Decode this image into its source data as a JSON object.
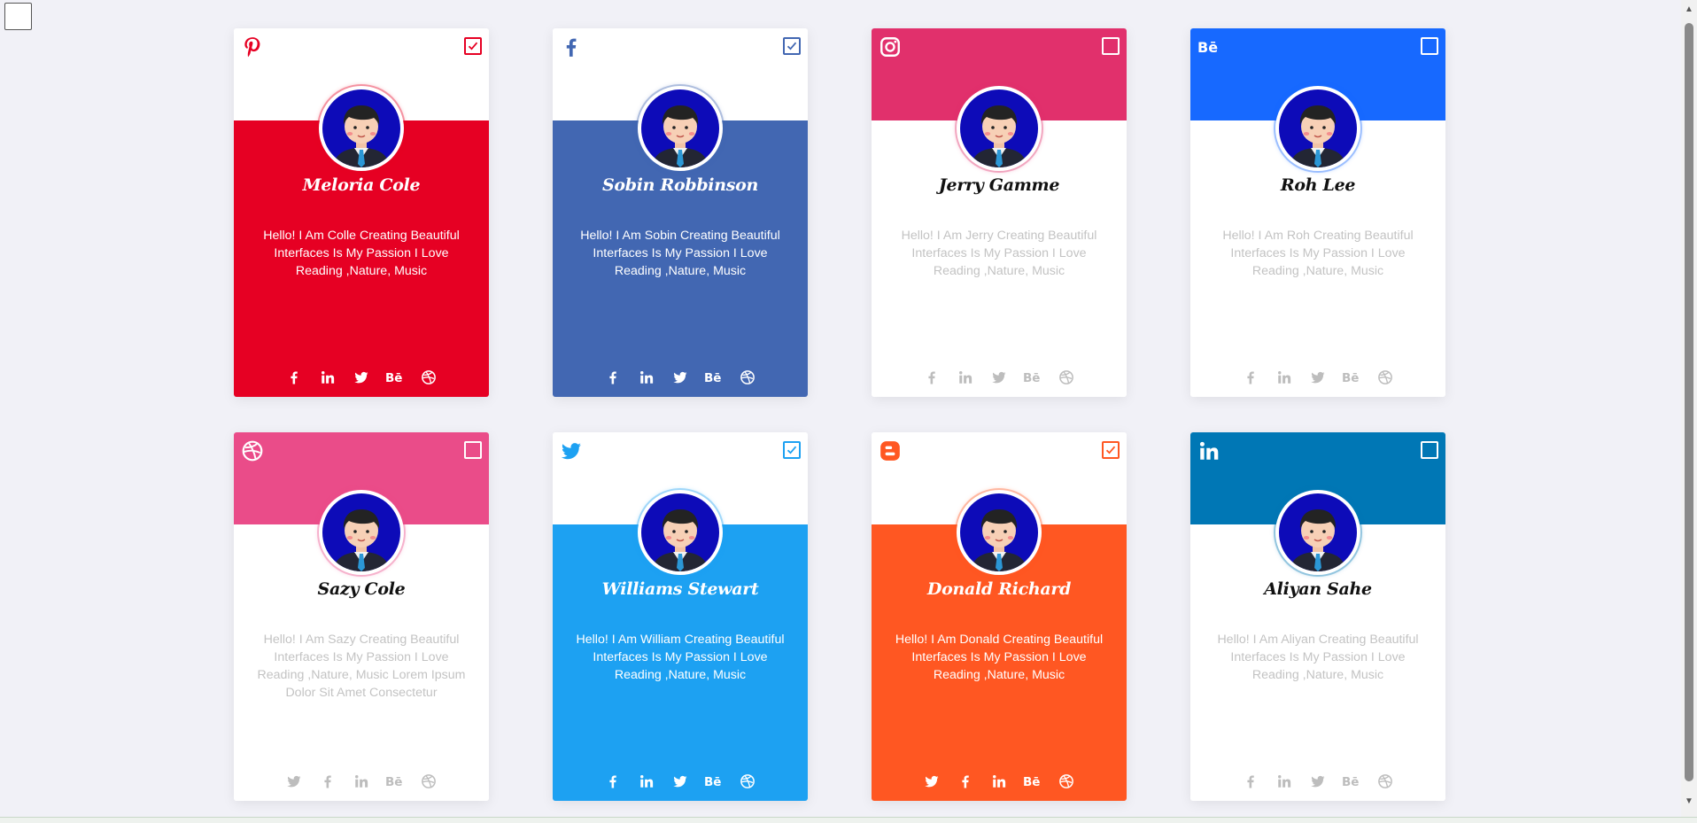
{
  "cards": [
    {
      "name": "Meloria Cole",
      "bio": "Hello! I Am Colle Creating Beautiful Interfaces Is My Passion I Love Reading ,Nature, Music",
      "brand": "pinterest-icon",
      "brand_color": "#e60023",
      "checked": true,
      "style": "body-filled",
      "socials": [
        "facebook-icon",
        "linkedin-icon",
        "twitter-icon",
        "behance-icon",
        "dribbble-icon"
      ]
    },
    {
      "name": "Sobin Robbinson",
      "bio": "Hello! I Am Sobin Creating Beautiful Interfaces Is My Passion I Love Reading ,Nature, Music",
      "brand": "facebook-icon",
      "brand_color": "#4267b2",
      "checked": true,
      "style": "body-filled",
      "socials": [
        "facebook-icon",
        "linkedin-icon",
        "twitter-icon",
        "behance-icon",
        "dribbble-icon"
      ]
    },
    {
      "name": "Jerry Gamme",
      "bio": "Hello! I Am Jerry Creating Beautiful Interfaces Is My Passion I Love Reading ,Nature, Music",
      "brand": "instagram-icon",
      "brand_color": "#e1306c",
      "checked": false,
      "style": "head-filled",
      "socials": [
        "facebook-icon",
        "linkedin-icon",
        "twitter-icon",
        "behance-icon",
        "dribbble-icon"
      ]
    },
    {
      "name": "Roh Lee",
      "bio": "Hello! I Am Roh Creating Beautiful Interfaces Is My Passion I Love Reading ,Nature, Music",
      "brand": "behance-icon",
      "brand_color": "#1769ff",
      "checked": false,
      "style": "head-filled",
      "socials": [
        "facebook-icon",
        "linkedin-icon",
        "twitter-icon",
        "behance-icon",
        "dribbble-icon"
      ]
    },
    {
      "name": "Sazy Cole",
      "bio": "Hello! I Am Sazy Creating Beautiful Interfaces Is My Passion I Love Reading ,Nature, Music Lorem Ipsum Dolor Sit Amet Consectetur",
      "brand": "dribbble-icon",
      "brand_color": "#ea4c89",
      "checked": false,
      "style": "head-filled",
      "socials": [
        "twitter-icon",
        "facebook-icon",
        "linkedin-icon",
        "behance-icon",
        "dribbble-icon"
      ]
    },
    {
      "name": "Williams Stewart",
      "bio": "Hello! I Am William Creating Beautiful Interfaces Is My Passion I Love Reading ,Nature, Music",
      "brand": "twitter-icon",
      "brand_color": "#1da1f2",
      "checked": true,
      "style": "body-filled",
      "socials": [
        "facebook-icon",
        "linkedin-icon",
        "twitter-icon",
        "behance-icon",
        "dribbble-icon"
      ]
    },
    {
      "name": "Donald Richard",
      "bio": "Hello! I Am Donald Creating Beautiful Interfaces Is My Passion I Love Reading ,Nature, Music",
      "brand": "blogger-icon",
      "brand_color": "#ff5722",
      "checked": true,
      "style": "body-filled",
      "socials": [
        "twitter-icon",
        "facebook-icon",
        "linkedin-icon",
        "behance-icon",
        "dribbble-icon"
      ]
    },
    {
      "name": "Aliyan Sahe",
      "bio": "Hello! I Am Aliyan Creating Beautiful Interfaces Is My Passion I Love Reading ,Nature, Music",
      "brand": "linkedin-icon",
      "brand_color": "#0077b5",
      "checked": false,
      "style": "head-filled",
      "socials": [
        "facebook-icon",
        "linkedin-icon",
        "twitter-icon",
        "behance-icon",
        "dribbble-icon"
      ]
    }
  ]
}
